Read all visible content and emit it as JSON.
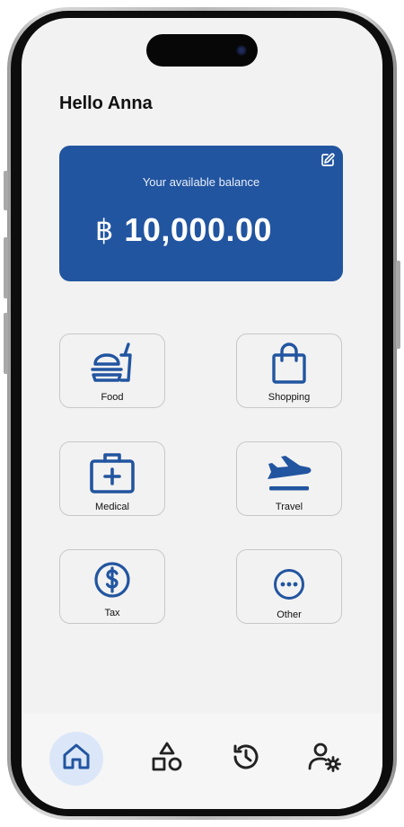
{
  "greeting": "Hello Anna",
  "balance": {
    "label": "Your available balance",
    "currency_symbol": "฿",
    "amount": "10,000.00"
  },
  "categories": [
    {
      "label": "Food",
      "icon": "food-icon"
    },
    {
      "label": "Shopping",
      "icon": "shopping-bag-icon"
    },
    {
      "label": "Medical",
      "icon": "medical-kit-icon"
    },
    {
      "label": "Travel",
      "icon": "airplane-departure-icon"
    },
    {
      "label": "Tax",
      "icon": "dollar-circle-icon"
    },
    {
      "label": "Other",
      "icon": "more-circle-icon"
    }
  ],
  "nav": [
    {
      "name": "home",
      "icon": "home-icon",
      "active": true
    },
    {
      "name": "categories",
      "icon": "shapes-icon",
      "active": false
    },
    {
      "name": "history",
      "icon": "history-icon",
      "active": false
    },
    {
      "name": "account-settings",
      "icon": "user-settings-icon",
      "active": false
    }
  ],
  "colors": {
    "primary": "#2255a0",
    "background": "#f2f2f2",
    "nav_active_bg": "#dbe7f8",
    "icon_dark": "#222222"
  }
}
